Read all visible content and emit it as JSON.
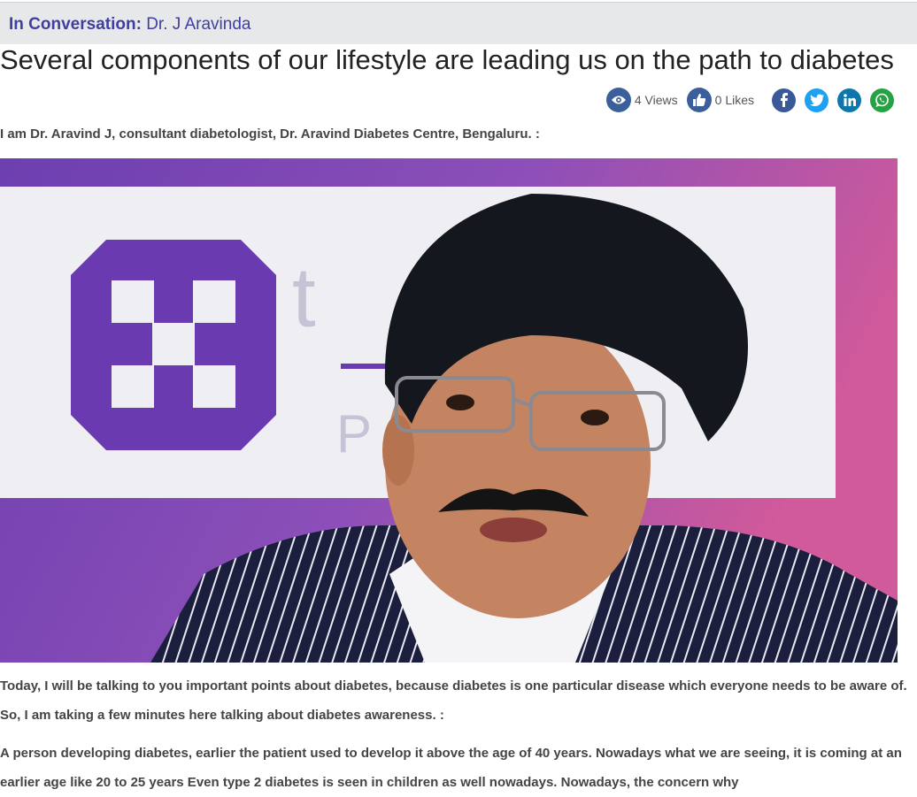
{
  "header": {
    "label": "In Conversation:",
    "name": "Dr. J Aravinda"
  },
  "article": {
    "title": "Several components of our lifestyle are leading us on the path to diabetes",
    "intro": "I am Dr. Aravind J, consultant diabetologist, Dr. Aravind Diabetes Centre, Bengaluru. :",
    "paragraphs": [
      "Today, I will be talking to you important points about diabetes, because diabetes is one particular disease which everyone needs to be aware of. So, I am taking a few minutes here talking about diabetes awareness. :",
      "A person developing diabetes, earlier the patient used to develop it above the age of 40 years. Nowadays what we are seeing, it is coming at an earlier age like 20 to 25 years Even type 2 diabetes is seen in children as well nowadays. Nowadays, the concern why"
    ]
  },
  "stats": {
    "views": "4 Views",
    "likes": "0 Likes"
  },
  "share": [
    {
      "icon": "facebook-icon",
      "color": "#3b5998"
    },
    {
      "icon": "twitter-icon",
      "color": "#1da1f2"
    },
    {
      "icon": "linkedin-icon",
      "color": "#0e76a8"
    },
    {
      "icon": "whatsapp-icon",
      "color": "#25a244"
    }
  ],
  "colors": {
    "accent": "#3f3fa0",
    "headerBg": "#e7e8ea",
    "photoBg": "#7a4fb3"
  }
}
